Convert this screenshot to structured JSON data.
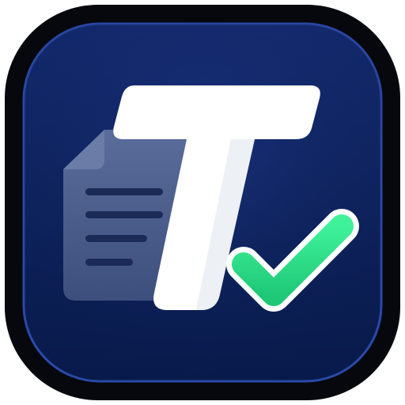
{
  "app_icon": {
    "glyph": "T",
    "colors": {
      "outer_frame": "#06080d",
      "tile_top": "#142a6e",
      "tile_bottom": "#081a4a",
      "tile_edge": "#2a49a8",
      "document_fill": "#4c5f8d",
      "document_fold": "#6b7ca6",
      "document_lines": "#1b2a57",
      "letter_fill": "#ffffff",
      "letter_shade": "#e6e9ef",
      "check_fill": "#2ee08a",
      "check_outline": "#ffffff"
    },
    "icons": [
      "document-icon",
      "letter-t-icon",
      "checkmark-icon"
    ]
  }
}
